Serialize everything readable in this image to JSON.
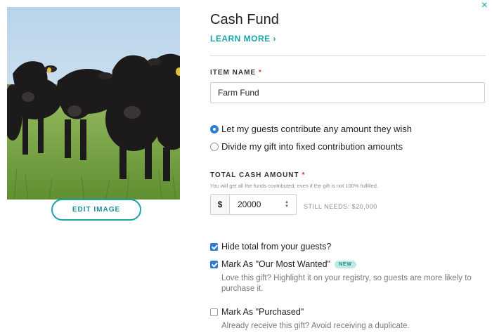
{
  "close_symbol": "×",
  "left": {
    "edit_image_label": "EDIT IMAGE"
  },
  "header": {
    "title": "Cash Fund",
    "learn_more": "LEARN MORE ›"
  },
  "item_name": {
    "label": "ITEM NAME",
    "required_mark": "*",
    "value": "Farm Fund"
  },
  "contribution": {
    "options": [
      {
        "label": "Let my guests contribute any amount they wish",
        "selected": true
      },
      {
        "label": "Divide my gift into fixed contribution amounts",
        "selected": false
      }
    ]
  },
  "cash": {
    "label": "TOTAL CASH AMOUNT",
    "required_mark": "*",
    "hint": "You will get all the funds contributed, even if the gift is not 100% fulfilled.",
    "currency": "$",
    "amount": "20000",
    "still_needs": "STILL NEEDS: $20,000"
  },
  "options": {
    "hide_total": {
      "label": "Hide total from your guests?",
      "checked": true
    },
    "most_wanted": {
      "label": "Mark As \"Our Most Wanted\"",
      "badge": "NEW",
      "checked": true,
      "help": "Love this gift? Highlight it on your registry, so guests are more likely to purchase it."
    },
    "purchased": {
      "label": "Mark As \"Purchased\"",
      "checked": false,
      "help": "Already receive this gift? Avoid receiving a duplicate."
    }
  },
  "colors": {
    "accent": "#1aa5ab",
    "checkbox": "#2b7cd3",
    "required": "#d8342c"
  }
}
